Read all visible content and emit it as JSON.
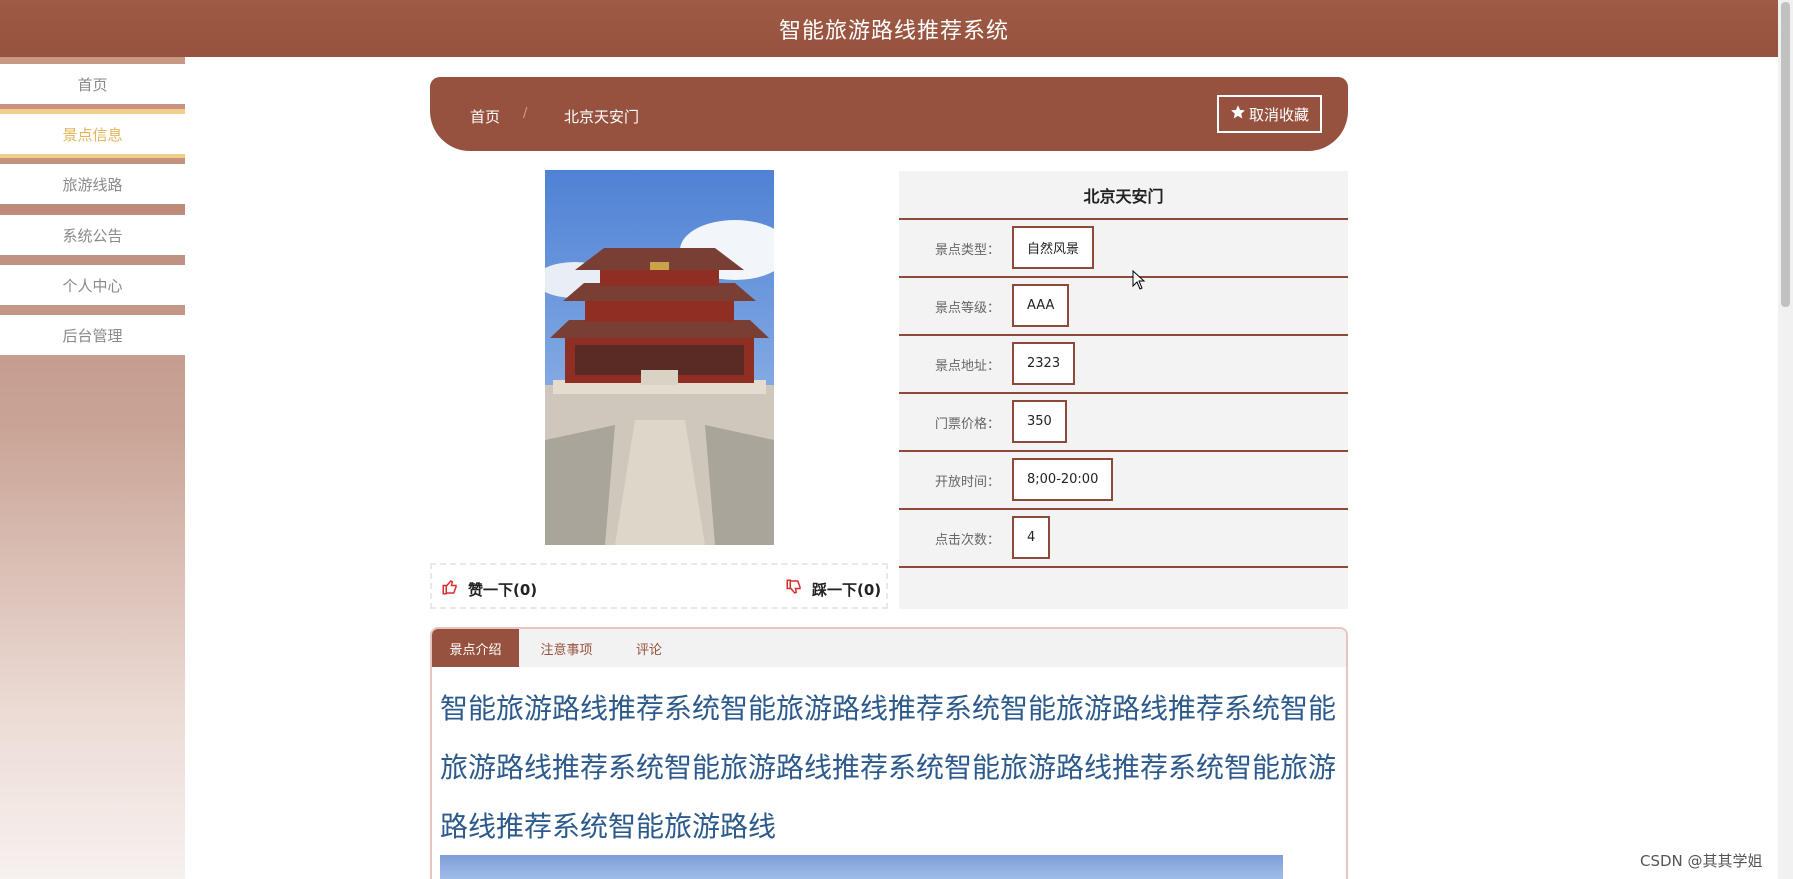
{
  "header": {
    "title": "智能旅游路线推荐系统"
  },
  "sidebar": {
    "items": [
      {
        "label": "首页"
      },
      {
        "label": "景点信息"
      },
      {
        "label": "旅游线路"
      },
      {
        "label": "系统公告"
      },
      {
        "label": "个人中心"
      },
      {
        "label": "后台管理"
      }
    ],
    "active_index": 1
  },
  "breadcrumb": {
    "home": "首页",
    "separator": "/",
    "current": "北京天安门"
  },
  "favorite_button": {
    "label": "取消收藏",
    "icon": "star-icon"
  },
  "spot": {
    "name": "北京天安门",
    "fields": [
      {
        "label": "景点类型：",
        "value": "自然风景"
      },
      {
        "label": "景点等级：",
        "value": "AAA"
      },
      {
        "label": "景点地址：",
        "value": "2323"
      },
      {
        "label": "门票价格：",
        "value": "350"
      },
      {
        "label": "开放时间：",
        "value": "8;00-20:00"
      },
      {
        "label": "点击次数：",
        "value": "4"
      }
    ]
  },
  "votes": {
    "like_label": "赞一下(0)",
    "dislike_label": "踩一下(0)",
    "like_icon": "thumbs-up-icon",
    "dislike_icon": "thumbs-down-icon"
  },
  "tabs": [
    {
      "label": "景点介绍",
      "active": true
    },
    {
      "label": "注意事项",
      "active": false
    },
    {
      "label": "评论",
      "active": false
    }
  ],
  "intro_text": "智能旅游路线推荐系统智能旅游路线推荐系统智能旅游路线推荐系统智能旅游路线推荐系统智能旅游路线推荐系统智能旅游路线推荐系统智能旅游路线推荐系统智能旅游路线",
  "watermark": "CSDN @其其学姐",
  "colors": {
    "primary": "#97523f",
    "active_menu": "#e6b45a",
    "intro_text": "#2c5a8c"
  }
}
